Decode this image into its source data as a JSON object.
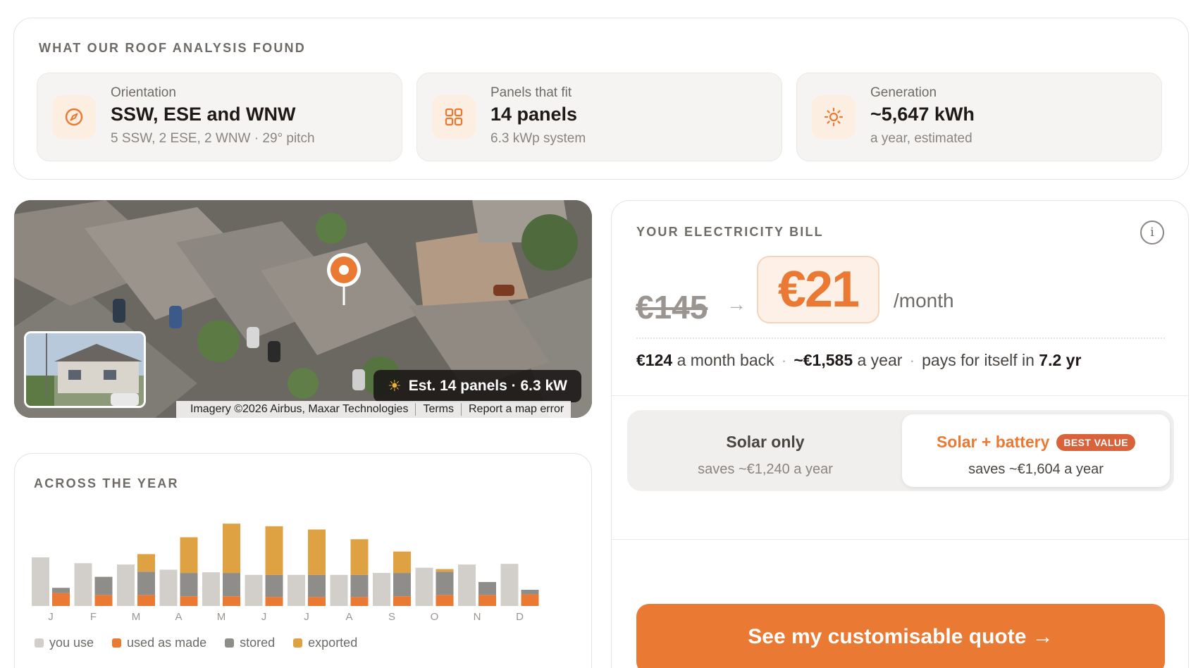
{
  "roof": {
    "title": "WHAT OUR ROOF ANALYSIS FOUND",
    "stats": [
      {
        "icon": "compass-icon",
        "label": "Orientation",
        "value": "SSW, ESE and WNW",
        "sub": "5 SSW, 2 ESE, 2 WNW · 29° pitch"
      },
      {
        "icon": "grid-icon",
        "label": "Panels that fit",
        "value": "14 panels",
        "sub": "6.3 kWp system"
      },
      {
        "icon": "sun-icon",
        "label": "Generation",
        "value": "~5,647 kWh",
        "sub": "a year, estimated"
      }
    ]
  },
  "map": {
    "estimate": "Est. 14 panels · 6.3 kW",
    "attribution": [
      "Imagery ©2026 Airbus, Maxar Technologies",
      "Terms",
      "Report a map error"
    ]
  },
  "year": {
    "title": "ACROSS THE YEAR",
    "legend": [
      "you use",
      "used as made",
      "stored",
      "exported"
    ]
  },
  "chart_data": {
    "type": "bar",
    "categories": [
      "J",
      "F",
      "M",
      "A",
      "M",
      "J",
      "J",
      "A",
      "S",
      "O",
      "N",
      "D"
    ],
    "series": [
      {
        "name": "you use",
        "values": [
          75,
          66,
          64,
          56,
          52,
          48,
          48,
          48,
          51,
          59,
          64,
          65
        ]
      },
      {
        "name": "used as made",
        "values": [
          20,
          17,
          17,
          15,
          15,
          14,
          14,
          14,
          15,
          17,
          17,
          18
        ]
      },
      {
        "name": "stored",
        "values": [
          8,
          28,
          36,
          36,
          36,
          34,
          34,
          34,
          36,
          36,
          20,
          7
        ]
      },
      {
        "name": "exported",
        "values": [
          0,
          0,
          27,
          55,
          76,
          75,
          70,
          55,
          33,
          4,
          0,
          0
        ]
      }
    ],
    "colors": {
      "you use": "#d2cfca",
      "used as made": "#ea7a33",
      "stored": "#8f8d8a",
      "exported": "#dfa243"
    }
  },
  "bill": {
    "title": "YOUR ELECTRICITY BILL",
    "info": "i",
    "old_price": "€145",
    "arrow": "→",
    "new_price": "€21",
    "per": "/month",
    "summary": {
      "monthly_back": "€124",
      "monthly_back_text": "a month back",
      "yearly": "~€1,585",
      "yearly_text": "a year",
      "payback_text": "pays for itself in",
      "payback": "7.2 yr"
    },
    "options": [
      {
        "title": "Solar only",
        "saves": "saves ~€1,240 a year"
      },
      {
        "title": "Solar + battery",
        "badge": "BEST VALUE",
        "saves": "saves ~€1,604 a year"
      }
    ],
    "cta": "See my customisable quote →"
  },
  "colors": {
    "accent": "#ea7a33",
    "badge": "#d9623a"
  }
}
